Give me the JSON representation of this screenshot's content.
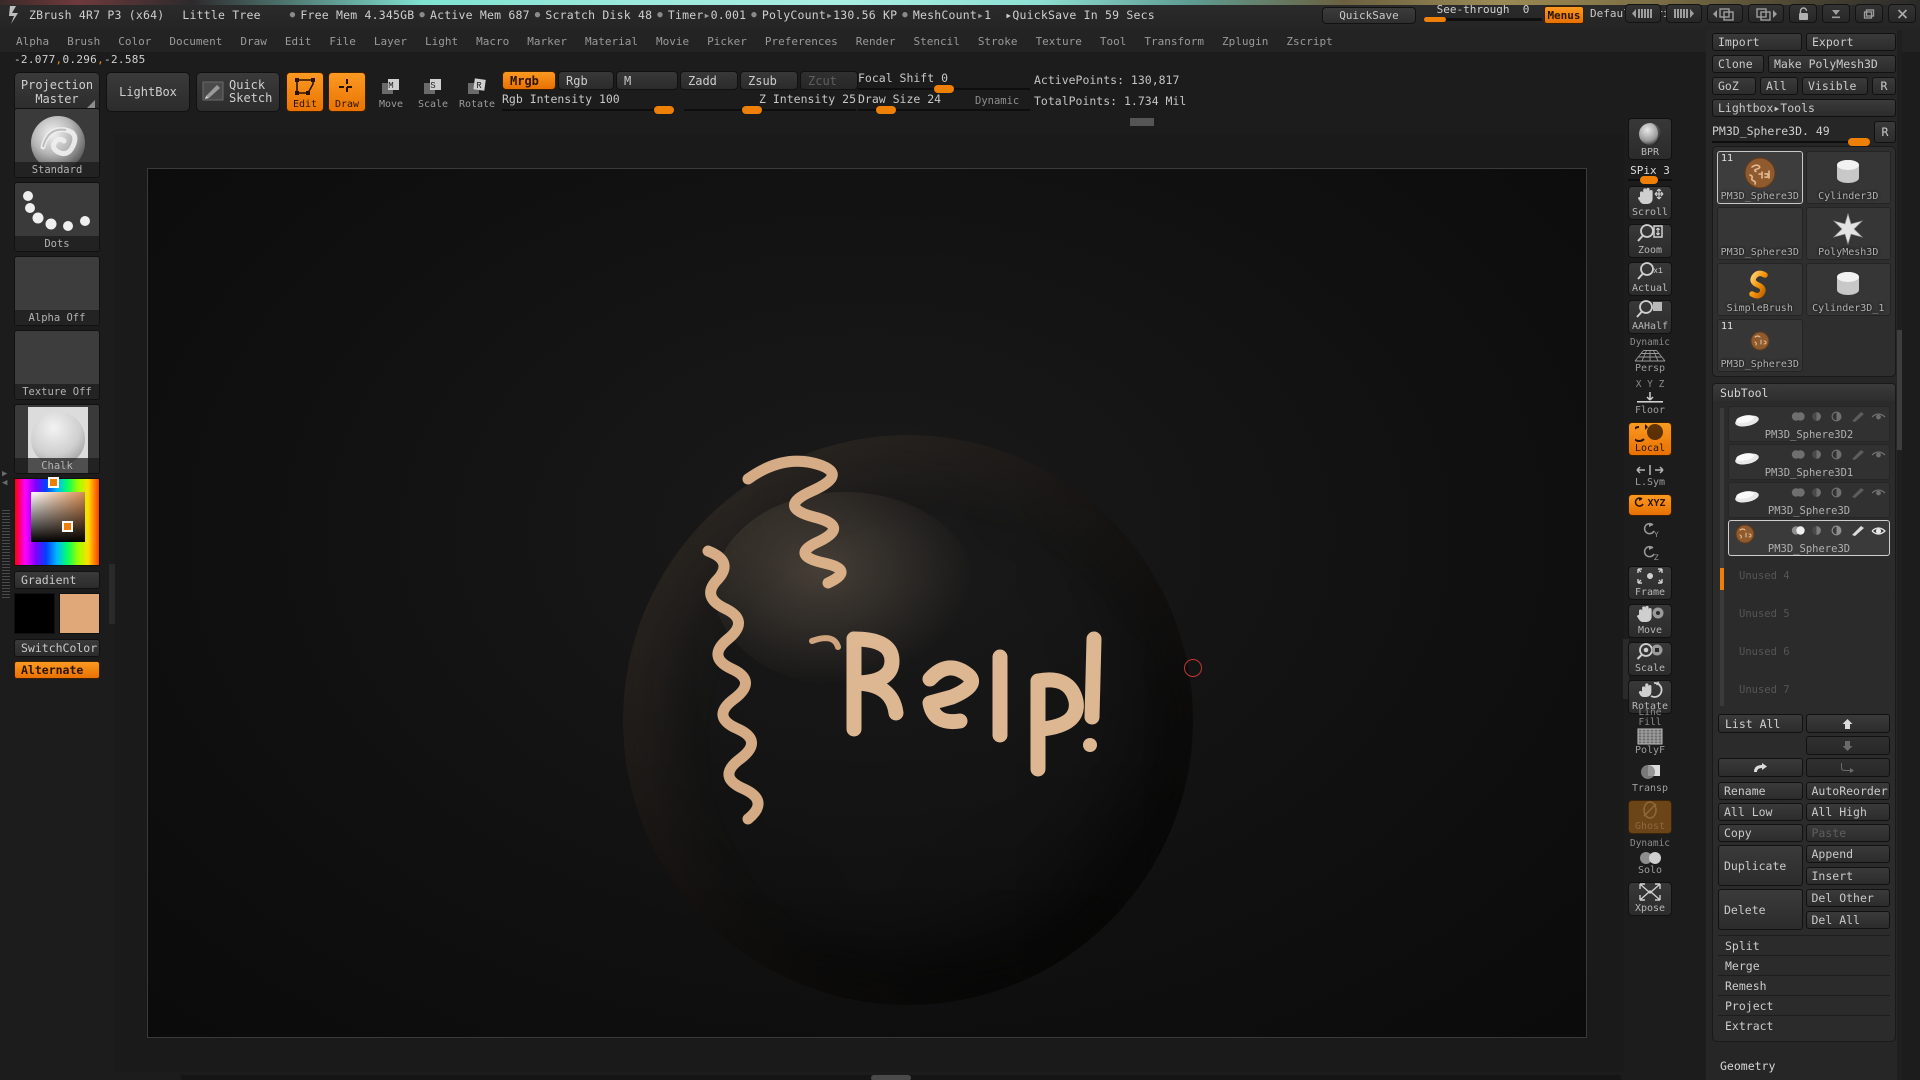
{
  "app": {
    "title": "ZBrush 4R7 P3 (x64)",
    "document_name": "Little Tree",
    "stats": [
      {
        "label": "Free Mem",
        "value": "4.345GB",
        "sep": "●"
      },
      {
        "label": "Active Mem",
        "value": "687",
        "sep": "●"
      },
      {
        "label": "Scratch Disk",
        "value": "48",
        "sep": "●"
      },
      {
        "label": "Timer",
        "value": "0.001",
        "sep": "●",
        "arrow": "▸"
      },
      {
        "label": "PolyCount",
        "value": "130.56 KP",
        "sep": "●",
        "arrow": "▸"
      },
      {
        "label": "MeshCount",
        "value": "1",
        "sep": "●",
        "arrow": "▸"
      }
    ],
    "quicksave_status": "▸QuickSave In 59 Secs",
    "quicksave_button": "QuickSave",
    "see_through_label": "See-through",
    "see_through_value": "0",
    "menus_button": "Menus",
    "zscript_label": "DefaultZScript"
  },
  "colors": {
    "accent": "#ef8007",
    "accent_light": "#fb9a22",
    "panel": "#262626",
    "panel_dark": "#1c1c1c",
    "button": "#333333",
    "text": "#c8c8c8",
    "cursor_ring": "#c0392b",
    "sphere_main": "#a9703f",
    "paint_stroke": "#e0b187"
  },
  "menubar": {
    "items": [
      "Alpha",
      "Brush",
      "Color",
      "Document",
      "Draw",
      "Edit",
      "File",
      "Layer",
      "Light",
      "Macro",
      "Marker",
      "Material",
      "Movie",
      "Picker",
      "Preferences",
      "Render",
      "Stencil",
      "Stroke",
      "Texture",
      "Tool",
      "Transform",
      "Zplugin",
      "Zscript"
    ]
  },
  "coords": {
    "x": "-2.077",
    "y": "0.296",
    "z": "-2.585",
    "full": "-2.077,0.296,-2.585"
  },
  "shelf": {
    "projection_master": "Projection\nMaster",
    "projection_master_l1": "Projection",
    "projection_master_l2": "Master",
    "lightbox": "LightBox",
    "quick_sketch_l1": "Quick",
    "quick_sketch_l2": "Sketch",
    "edit": "Edit",
    "draw": "Draw",
    "move": "Move",
    "scale": "Scale",
    "rotate": "Rotate",
    "mrgb": "Mrgb",
    "rgb": "Rgb",
    "m": "M",
    "zadd": "Zadd",
    "zsub": "Zsub",
    "zcut": "Zcut",
    "rgb_intensity_label": "Rgb Intensity",
    "rgb_intensity_value": "100",
    "z_intensity_label": "Z Intensity",
    "z_intensity_value": "25",
    "focal_shift_label": "Focal Shift",
    "focal_shift_value": "0",
    "draw_size_label": "Draw Size",
    "draw_size_value": "24",
    "dynamic": "Dynamic",
    "active_points": "ActivePoints: 130,817",
    "total_points": "TotalPoints: 1.734 Mil"
  },
  "left_palette": {
    "brush": {
      "caption": "Standard",
      "name": "brush-swatch"
    },
    "stroke": {
      "caption": "Dots",
      "name": "stroke-swatch"
    },
    "alpha": {
      "caption": "Alpha Off",
      "name": "alpha-swatch"
    },
    "texture": {
      "caption": "Texture Off",
      "name": "texture-swatch"
    },
    "material": {
      "caption": "Chalk",
      "name": "material-swatch"
    },
    "gradient": "Gradient",
    "switch_color": "SwitchColor",
    "alternate": "Alternate",
    "primary_color": "#000000",
    "secondary_color": "#e0a878"
  },
  "right_shelf": {
    "bpr": "BPR",
    "spix_label": "SPix",
    "spix_value": "3",
    "items": [
      {
        "label": "Scroll",
        "icon": "hand-scroll-icon",
        "state": "off"
      },
      {
        "label": "Zoom",
        "icon": "magnifier-zoom-icon",
        "state": "off"
      },
      {
        "label": "Actual",
        "icon": "magnifier-actual-icon",
        "state": "off"
      },
      {
        "label": "AAHalf",
        "icon": "magnifier-aahalf-icon",
        "state": "off"
      },
      {
        "label": "Persp",
        "icon": "perspective-grid-icon",
        "state": "flat",
        "top": "Dynamic"
      },
      {
        "label": "Floor",
        "icon": "floor-grid-icon",
        "state": "flat",
        "top": "X Y Z"
      },
      {
        "label": "Local",
        "icon": "local-pivot-icon",
        "state": "on"
      },
      {
        "label": "L.Sym",
        "icon": "local-symmetry-icon",
        "state": "flat"
      }
    ],
    "xyz": "XYZ",
    "rot_y": "Y",
    "rot_z": "Z",
    "items2": [
      {
        "label": "Frame",
        "icon": "frame-icon",
        "state": "off"
      },
      {
        "label": "Move",
        "icon": "move-hand-icon",
        "state": "off"
      },
      {
        "label": "Scale",
        "icon": "scale-icon",
        "state": "off"
      },
      {
        "label": "Rotate",
        "icon": "rotate-icon",
        "state": "off"
      },
      {
        "label": "PolyF",
        "icon": "polyframe-icon",
        "state": "flat",
        "top": "Line Fill"
      },
      {
        "label": "Transp",
        "icon": "transparency-icon",
        "state": "flat"
      },
      {
        "label": "Ghost",
        "icon": "ghost-icon",
        "state": "ghost"
      },
      {
        "label": "Solo",
        "icon": "solo-icon",
        "state": "flat",
        "top": "Dynamic"
      },
      {
        "label": "Xpose",
        "icon": "xpose-icon",
        "state": "off"
      }
    ]
  },
  "tool_panel": {
    "import": "Import",
    "export": "Export",
    "clone": "Clone",
    "make_polymesh3d": "Make PolyMesh3D",
    "goz": "GoZ",
    "all": "All",
    "visible": "Visible",
    "r_small": "R",
    "lightbox_tools": "Lightbox▸Tools",
    "current_tool": "PM3D_Sphere3D. 49",
    "current_tool_r": "R",
    "items": [
      {
        "name": "PM3D_Sphere3D",
        "badge": "11",
        "selected": true,
        "art": "painted-sphere"
      },
      {
        "name": "Cylinder3D",
        "badge": "",
        "selected": false,
        "art": "cylinder"
      },
      {
        "name": "PM3D_Sphere3D",
        "badge": "",
        "selected": false,
        "art": "none"
      },
      {
        "name": "PolyMesh3D",
        "badge": "",
        "selected": false,
        "art": "star"
      },
      {
        "name": "SimpleBrush",
        "badge": "",
        "selected": false,
        "art": "s-brush"
      },
      {
        "name": "Cylinder3D_1",
        "badge": "",
        "selected": false,
        "art": "cylinder"
      },
      {
        "name": "PM3D_Sphere3D",
        "badge": "11",
        "selected": false,
        "art": "painted-sphere-small"
      }
    ]
  },
  "subtool": {
    "header": "SubTool",
    "rows": [
      {
        "name": "PM3D_Sphere3D2",
        "selected": false,
        "unused": false
      },
      {
        "name": "PM3D_Sphere3D1",
        "selected": false,
        "unused": false
      },
      {
        "name": "PM3D_Sphere3D",
        "selected": false,
        "unused": false
      },
      {
        "name": "PM3D_Sphere3D",
        "selected": true,
        "unused": false
      },
      {
        "name": "Unused 4",
        "selected": false,
        "unused": true
      },
      {
        "name": "Unused 5",
        "selected": false,
        "unused": true
      },
      {
        "name": "Unused 6",
        "selected": false,
        "unused": true
      },
      {
        "name": "Unused 7",
        "selected": false,
        "unused": true
      }
    ],
    "list_all": "List All",
    "nav_up": "⬆",
    "nav_down": "⬇",
    "nav_right": "➡",
    "nav_right2": "↳",
    "buttons": [
      {
        "left": "Rename",
        "right": "AutoReorder",
        "left_dim": false,
        "right_dim": false
      },
      {
        "left": "All Low",
        "right": "All High",
        "left_dim": false,
        "right_dim": false
      },
      {
        "left": "Copy",
        "right": "Paste",
        "left_dim": false,
        "right_dim": true
      }
    ],
    "duplicate": "Duplicate",
    "append": "Append",
    "insert": "Insert",
    "delete": "Delete",
    "del_other": "Del Other",
    "del_all": "Del All",
    "list_rows": [
      "Split",
      "Merge",
      "Remesh",
      "Project",
      "Extract"
    ],
    "geometry": "Geometry"
  }
}
